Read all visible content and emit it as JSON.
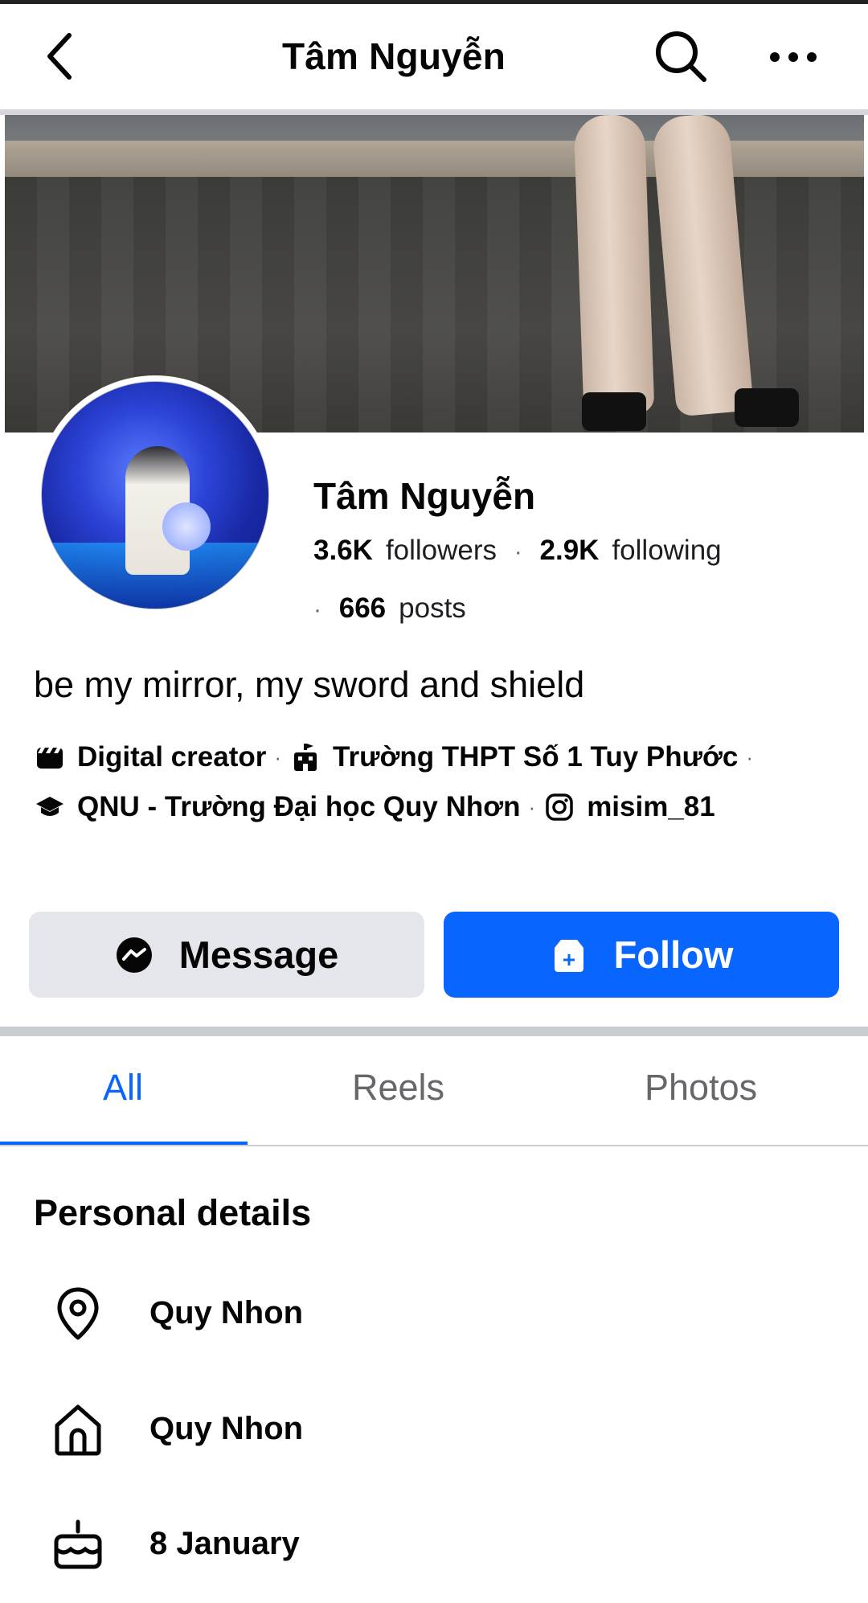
{
  "header": {
    "title": "Tâm Nguyễn",
    "back_icon": "chevron-left-icon",
    "search_icon": "search-icon",
    "more_icon": "more-horizontal-icon"
  },
  "profile": {
    "name": "Tâm Nguyễn",
    "followers_count": "3.6K",
    "followers_label": "followers",
    "following_count": "2.9K",
    "following_label": "following",
    "posts_count": "666",
    "posts_label": "posts",
    "bio": "be my mirror, my sword and shield",
    "info": {
      "category": "Digital creator",
      "school": "Trường THPT Số 1 Tuy Phước",
      "university": "QNU - Trường Đại học Quy Nhơn",
      "instagram": "misim_81"
    }
  },
  "actions": {
    "message_label": "Message",
    "follow_label": "Follow"
  },
  "tabs": [
    {
      "label": "All",
      "active": true
    },
    {
      "label": "Reels",
      "active": false
    },
    {
      "label": "Photos",
      "active": false
    }
  ],
  "personal_details": {
    "title": "Personal details",
    "items": [
      {
        "icon": "location-pin-icon",
        "text": "Quy Nhon"
      },
      {
        "icon": "home-icon",
        "text": "Quy Nhon"
      },
      {
        "icon": "birthday-cake-icon",
        "text": "8 January"
      }
    ]
  },
  "colors": {
    "accent": "#0866ff",
    "secondary_button": "#e4e6eb",
    "muted_text": "#65676b"
  }
}
